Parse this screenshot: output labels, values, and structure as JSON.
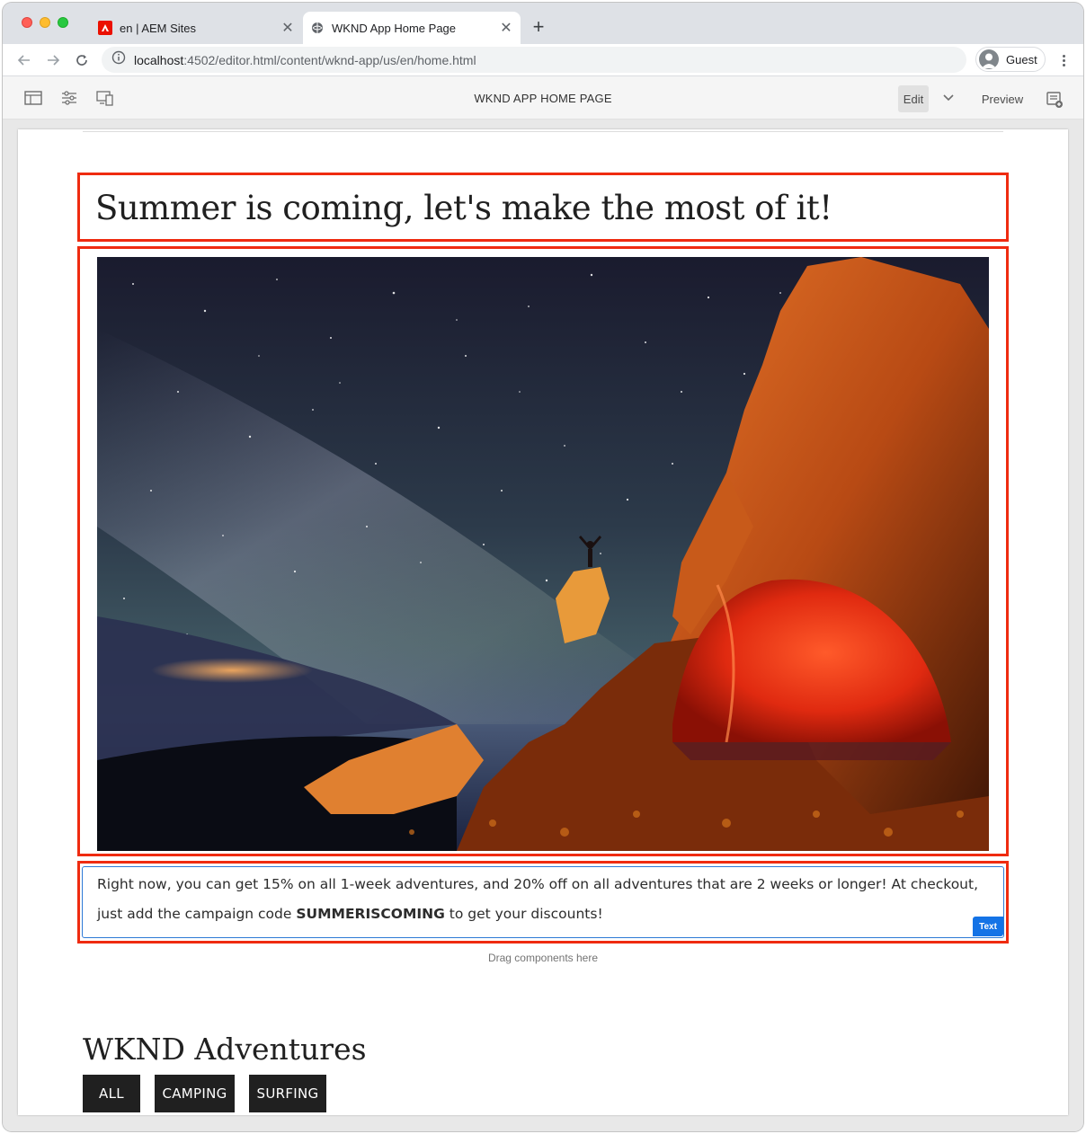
{
  "browser": {
    "tabs": [
      {
        "title": "en | AEM Sites",
        "favicon": "adobe-icon",
        "active": false
      },
      {
        "title": "WKND App Home Page",
        "favicon": "globe-icon",
        "active": true
      }
    ],
    "url_host": "localhost",
    "url_path": ":4502/editor.html/content/wknd-app/us/en/home.html",
    "profile_label": "Guest"
  },
  "editor": {
    "page_title": "WKND APP HOME PAGE",
    "edit_label": "Edit",
    "preview_label": "Preview"
  },
  "content": {
    "headline": "Summer is coming, let's make the most of it!",
    "hero_image_icon": "starry-night-camping-photo",
    "body_text_part1": "Right now, you can get 15% on all 1-week adventures, and 20% off on all adventures that are 2 weeks or longer!  At checkout, just add the campaign code ",
    "body_text_code": "SUMMERISCOMING",
    "body_text_part2": " to get your discounts!",
    "text_component_badge": "Text",
    "drag_hint": "Drag components here",
    "adventures_title": "WKND Adventures",
    "filters": [
      "ALL",
      "CAMPING",
      "SURFING"
    ]
  },
  "colors": {
    "selection_outline": "#ef2b10",
    "badge_blue": "#1473e6",
    "filter_bg": "#202020"
  }
}
